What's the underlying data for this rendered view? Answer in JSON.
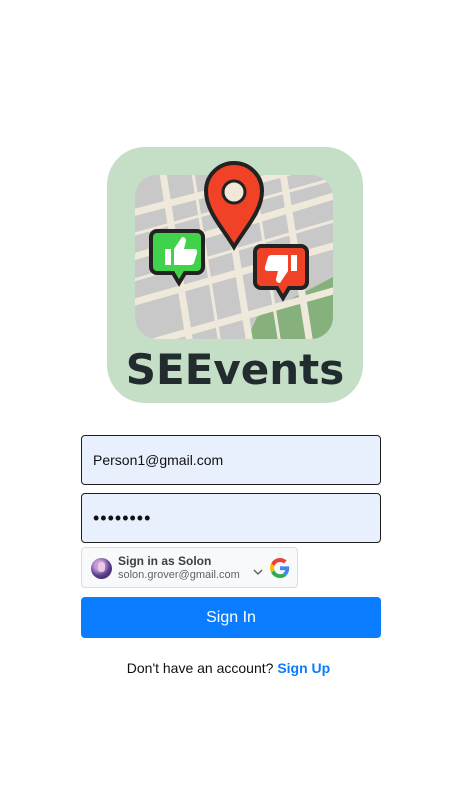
{
  "logo": {
    "text": "SEEvents",
    "icons": [
      "location-pin-icon",
      "thumbs-up-icon",
      "thumbs-down-icon"
    ],
    "colors": {
      "tile": "#c5dfc7",
      "map": "#c8c8c8",
      "pin": "#ef4227",
      "thumbs_up": "#3fd24a",
      "thumbs_down": "#ef4227"
    }
  },
  "form": {
    "email_value": "Person1@gmail.com",
    "password_value": "password"
  },
  "google": {
    "title": "Sign in as Solon",
    "email": "solon.grover@gmail.com",
    "icons": [
      "avatar",
      "chevron-down-icon",
      "google-g-icon"
    ]
  },
  "signin": {
    "label": "Sign In",
    "color": "#0a7cff"
  },
  "signup": {
    "prompt": "Don't have an account?",
    "link_label": "Sign Up"
  }
}
